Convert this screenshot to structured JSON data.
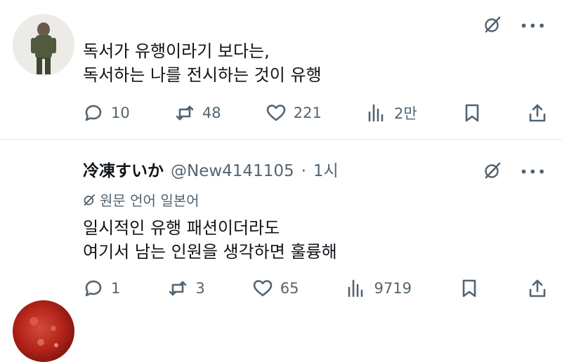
{
  "post1": {
    "text": "독서가 유행이라기 보다는,\n독서하는 나를 전시하는 것이 유행",
    "stats": {
      "replies": "10",
      "reposts": "48",
      "likes": "221",
      "views": "2만"
    }
  },
  "post2": {
    "display_name": "冷凍すいか",
    "handle": "@New4141105",
    "separator": "·",
    "time": "1시",
    "translate_label": "원문 언어 일본어",
    "text": "일시적인 유행 패션이더라도\n여기서 남는 인원을 생각하면 훌륭해",
    "stats": {
      "replies": "1",
      "reposts": "3",
      "likes": "65",
      "views": "9719"
    }
  },
  "icons": {
    "grok": "grok-icon",
    "more": "more-icon",
    "reply": "reply-icon",
    "repost": "repost-icon",
    "like": "like-icon",
    "views": "views-icon",
    "bookmark": "bookmark-icon",
    "share": "share-icon"
  },
  "colors": {
    "text": "#0f1419",
    "muted": "#536471",
    "divider": "#e6e8ea"
  }
}
